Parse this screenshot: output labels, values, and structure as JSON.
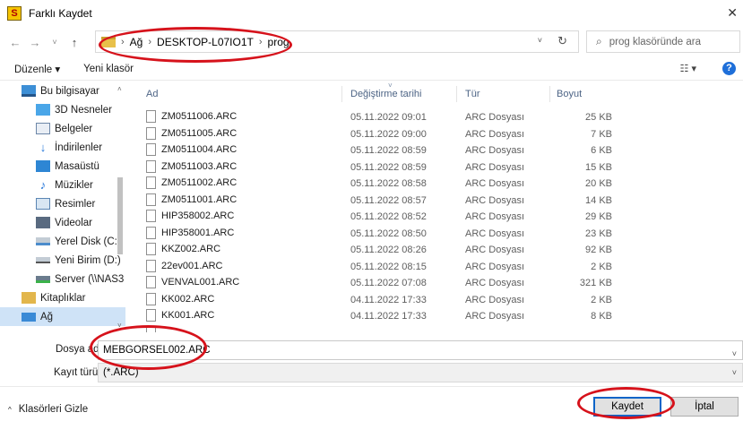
{
  "window": {
    "title": "Farklı Kaydet",
    "app_icon_letter": "S",
    "close_glyph": "✕"
  },
  "nav": {
    "back_glyph": "←",
    "forward_glyph": "→",
    "recent_glyph": "˅",
    "up_glyph": "↑",
    "breadcrumb": [
      "Ağ",
      "DESKTOP-L07IO1T",
      "prog"
    ],
    "separator": "›",
    "dropdown_glyph": "˅",
    "refresh_glyph": "↻",
    "search_placeholder": "prog klasöründe ara",
    "search_glyph": "⌕"
  },
  "toolbar": {
    "organize_label": "Düzenle ▾",
    "new_folder_label": "Yeni klasör",
    "view_glyph": "☷ ▾",
    "help_glyph": "?"
  },
  "sidebar": {
    "items": [
      {
        "label": "Bu bilgisayar",
        "icon": "computer-icon"
      },
      {
        "label": "3D Nesneler",
        "icon": "3d-objects-icon"
      },
      {
        "label": "Belgeler",
        "icon": "documents-icon"
      },
      {
        "label": "İndirilenler",
        "icon": "downloads-icon"
      },
      {
        "label": "Masaüstü",
        "icon": "desktop-icon"
      },
      {
        "label": "Müzikler",
        "icon": "music-icon"
      },
      {
        "label": "Resimler",
        "icon": "pictures-icon"
      },
      {
        "label": "Videolar",
        "icon": "videos-icon"
      },
      {
        "label": "Yerel Disk (C:)",
        "icon": "local-disk-icon"
      },
      {
        "label": "Yeni Birim (D:)",
        "icon": "drive-icon"
      },
      {
        "label": "Server (\\\\NAS3",
        "icon": "network-drive-icon"
      },
      {
        "label": "Kitaplıklar",
        "icon": "libraries-icon"
      },
      {
        "label": "Ağ",
        "icon": "network-icon"
      }
    ],
    "scroll_up_glyph": "˄",
    "scroll_down_glyph": "˅"
  },
  "filelist": {
    "columns": {
      "name": "Ad",
      "date": "Değiştirme tarihi",
      "type": "Tür",
      "size": "Boyut"
    },
    "sort_glyph": "˅",
    "rows": [
      {
        "name": "ZM0511006.ARC",
        "date": "05.11.2022 09:01",
        "type": "ARC Dosyası",
        "size": "25 KB"
      },
      {
        "name": "ZM0511005.ARC",
        "date": "05.11.2022 09:00",
        "type": "ARC Dosyası",
        "size": "7 KB"
      },
      {
        "name": "ZM0511004.ARC",
        "date": "05.11.2022 08:59",
        "type": "ARC Dosyası",
        "size": "6 KB"
      },
      {
        "name": "ZM0511003.ARC",
        "date": "05.11.2022 08:59",
        "type": "ARC Dosyası",
        "size": "15 KB"
      },
      {
        "name": "ZM0511002.ARC",
        "date": "05.11.2022 08:58",
        "type": "ARC Dosyası",
        "size": "20 KB"
      },
      {
        "name": "ZM0511001.ARC",
        "date": "05.11.2022 08:57",
        "type": "ARC Dosyası",
        "size": "14 KB"
      },
      {
        "name": "HIP358002.ARC",
        "date": "05.11.2022 08:52",
        "type": "ARC Dosyası",
        "size": "29 KB"
      },
      {
        "name": "HIP358001.ARC",
        "date": "05.11.2022 08:50",
        "type": "ARC Dosyası",
        "size": "23 KB"
      },
      {
        "name": "KKZ002.ARC",
        "date": "05.11.2022 08:26",
        "type": "ARC Dosyası",
        "size": "92 KB"
      },
      {
        "name": "22ev001.ARC",
        "date": "05.11.2022 08:15",
        "type": "ARC Dosyası",
        "size": "2 KB"
      },
      {
        "name": "VENVAL001.ARC",
        "date": "05.11.2022 07:08",
        "type": "ARC Dosyası",
        "size": "321 KB"
      },
      {
        "name": "KK002.ARC",
        "date": "04.11.2022 17:33",
        "type": "ARC Dosyası",
        "size": "2 KB"
      },
      {
        "name": "KK001.ARC",
        "date": "04.11.2022 17:33",
        "type": "ARC Dosyası",
        "size": "8 KB"
      }
    ]
  },
  "form": {
    "filename_label": "Dosya adı:",
    "filename_value": "MEBGORSEL002.ARC",
    "filetype_label": "Kayıt türü:",
    "filetype_value": "(*.ARC)",
    "caret_glyph": "˅"
  },
  "footer": {
    "hide_folders_caret": "^",
    "hide_folders_label": "Klasörleri Gizle",
    "save_label": "Kaydet",
    "cancel_label": "İptal"
  },
  "colors": {
    "annotation_red": "#d6121b",
    "selection_blue": "#cfe3f7",
    "primary_button_border": "#0a64c8",
    "column_header_text": "#4d6485"
  }
}
